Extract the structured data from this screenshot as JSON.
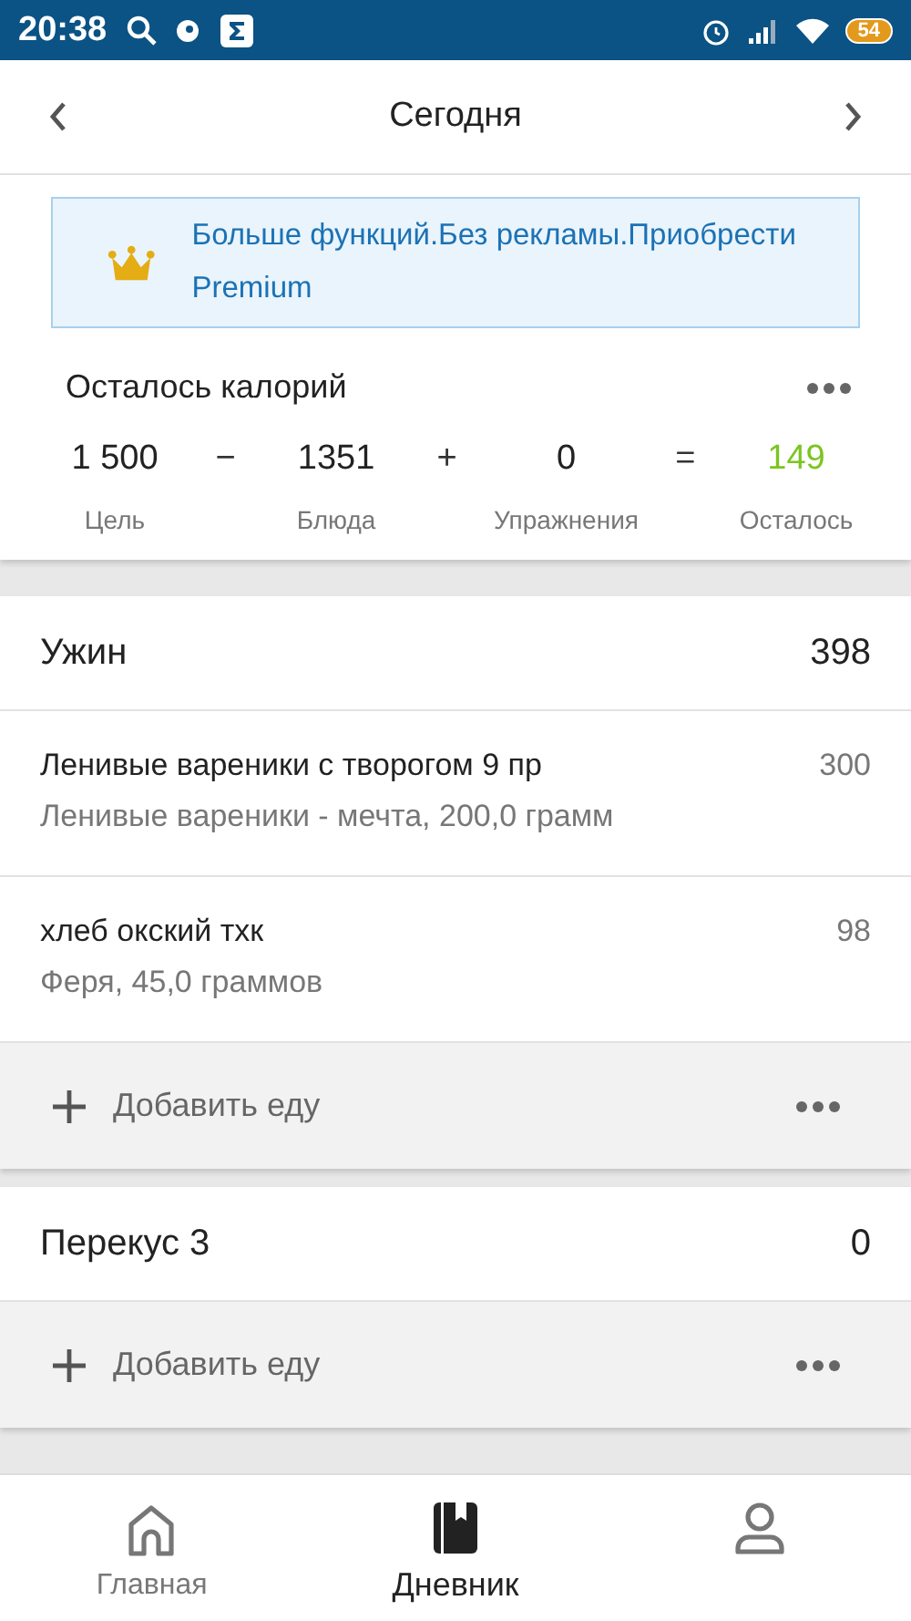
{
  "status_bar": {
    "time": "20:38",
    "battery": "54"
  },
  "header": {
    "title": "Сегодня"
  },
  "banner": {
    "text": "Больше функций.Без рекламы.Приобрести Premium"
  },
  "calories": {
    "title": "Осталось калорий",
    "terms": [
      {
        "value": "1 500",
        "label": "Цель",
        "op": "−",
        "kind": "plain"
      },
      {
        "value": "1351",
        "label": "Блюда",
        "op": "+",
        "kind": "plain"
      },
      {
        "value": "0",
        "label": "Упражнения",
        "op": "=",
        "kind": "plain"
      },
      {
        "value": "149",
        "label": "Осталось",
        "kind": "result"
      }
    ]
  },
  "meals": [
    {
      "name": "Ужин",
      "total": "398",
      "add_label": "Добавить еду",
      "items": [
        {
          "name": "Ленивые вареники с творогом 9 пр",
          "detail": "Ленивые вареники - мечта, 200,0 грамм",
          "calories": "300"
        },
        {
          "name": "хлеб окский тхк",
          "detail": "Феря, 45,0 граммов",
          "calories": "98"
        }
      ]
    },
    {
      "name": "Перекус 3",
      "total": "0",
      "add_label": "Добавить еду"
    }
  ],
  "nav": [
    {
      "kind": "home",
      "label": "Главная",
      "selected": false
    },
    {
      "kind": "diary",
      "label": "Дневник",
      "selected": true
    },
    {
      "kind": "profile",
      "selected": false
    }
  ]
}
